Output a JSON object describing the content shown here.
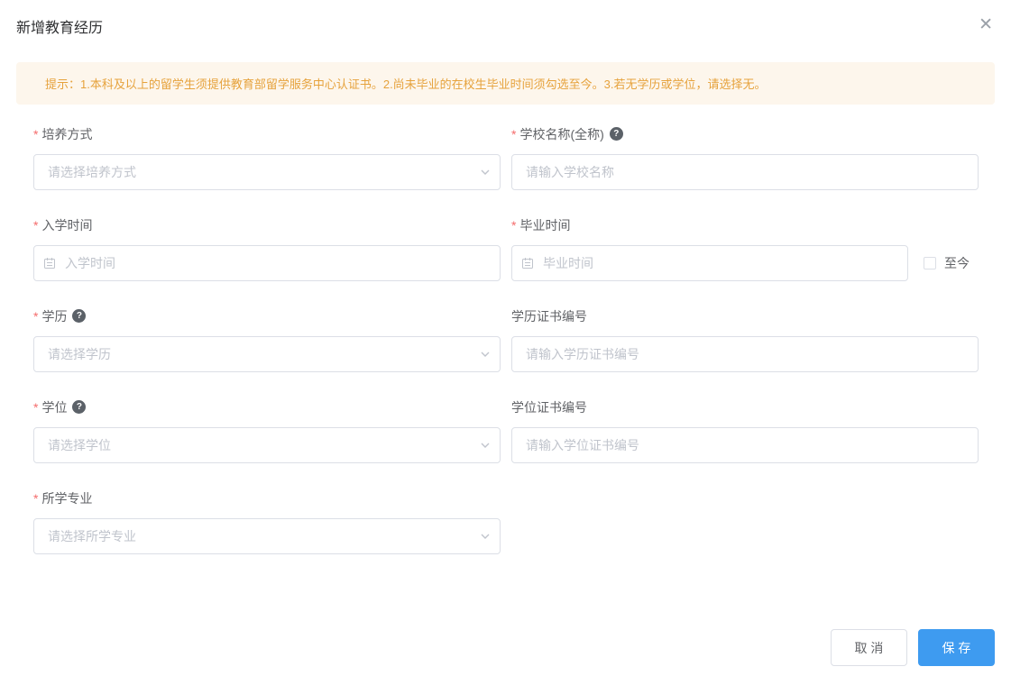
{
  "dialog": {
    "title": "新增教育经历",
    "close_icon": "✕"
  },
  "alert": {
    "text": "提示：1.本科及以上的留学生须提供教育部留学服务中心认证书。2.尚未毕业的在校生毕业时间须勾选至今。3.若无学历或学位，请选择无。"
  },
  "form": {
    "fields": [
      {
        "label": "培养方式",
        "required": true,
        "type": "select",
        "placeholder": "请选择培养方式"
      },
      {
        "label": "学校名称(全称)",
        "required": true,
        "help": true,
        "type": "text",
        "placeholder": "请输入学校名称"
      },
      {
        "label": "入学时间",
        "required": true,
        "type": "date",
        "placeholder": "入学时间"
      },
      {
        "label": "毕业时间",
        "required": true,
        "type": "date",
        "placeholder": "毕业时间"
      },
      {
        "label": "学历",
        "required": true,
        "help": true,
        "type": "select",
        "placeholder": "请选择学历"
      },
      {
        "label": "学历证书编号",
        "required": false,
        "type": "text",
        "placeholder": "请输入学历证书编号"
      },
      {
        "label": "学位",
        "required": true,
        "help": true,
        "type": "select",
        "placeholder": "请选择学位"
      },
      {
        "label": "学位证书编号",
        "required": false,
        "type": "text",
        "placeholder": "请输入学位证书编号"
      },
      {
        "label": "所学专业",
        "required": true,
        "type": "select",
        "placeholder": "请选择所学专业"
      }
    ],
    "required_mark": "*",
    "help_glyph": "?",
    "to_present_label": "至今"
  },
  "footer": {
    "cancel_label": "取 消",
    "save_label": "保 存"
  },
  "colors": {
    "primary": "#3e9bf0",
    "alert_bg": "#fdf6ec",
    "alert_text": "#e6a23c",
    "required": "#f56c6c",
    "input_border": "#dcdfe6",
    "placeholder": "#c0c4cc",
    "label_text": "#606266",
    "title_text": "#303133"
  }
}
